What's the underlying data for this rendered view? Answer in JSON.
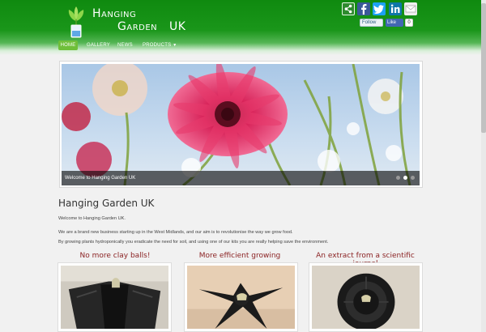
{
  "header": {
    "brand_line1": "Hanging",
    "brand_line2": "Garden   UK"
  },
  "social": {
    "icons": [
      "share-icon",
      "facebook-icon",
      "twitter-icon",
      "linkedin-icon",
      "mail-icon"
    ],
    "follow_label": "Follow",
    "like_label": "Like",
    "like_count": "0"
  },
  "nav": {
    "home": "HOME",
    "gallery": "GALLERY",
    "news": "NEWS",
    "products": "PRODUCTS",
    "active": "HOME"
  },
  "slider": {
    "caption": "Welcome to Hanging Garden UK",
    "slide_count": 3,
    "active_slide": 2
  },
  "content": {
    "title": "Hanging Garden UK",
    "intro": "Welcome to Hanging Garden UK.",
    "para1": "We are a brand new business starting up in the West Midlands, and our aim is to revolutionise the way we grow food.",
    "para2": "By growing plants hydroponically you eradicate the need for soil, and using one of our kits you are really helping save the environment."
  },
  "features": [
    {
      "title": "No more clay balls!"
    },
    {
      "title": "More efficient growing"
    },
    {
      "title": "An extract from a scientific journal"
    }
  ],
  "colors": {
    "header_green": "#1a961a",
    "nav_active": "#6fbf3a",
    "feature_title": "#8b2324",
    "background": "#f1f1f1"
  }
}
